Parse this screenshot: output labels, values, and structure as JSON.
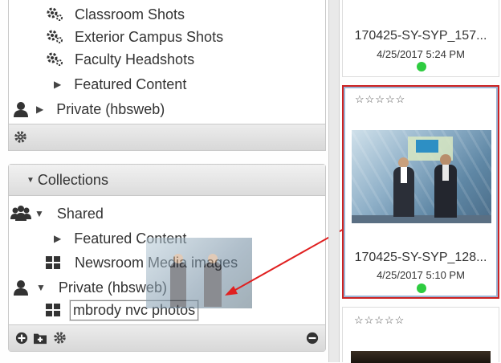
{
  "tree_top": {
    "items": [
      {
        "label": "Classroom Shots",
        "icon": "gears-icon"
      },
      {
        "label": "Exterior Campus Shots",
        "icon": "gears-icon"
      },
      {
        "label": "Faculty Headshots",
        "icon": "gears-icon"
      },
      {
        "label": "Featured Content",
        "icon": "triangle-right-icon"
      },
      {
        "label": "Private (hbsweb)",
        "icon": "user-icon"
      }
    ]
  },
  "collections": {
    "header": "Collections",
    "items": [
      {
        "label": "Shared",
        "icon": "users-icon"
      },
      {
        "label": "Featured Content",
        "icon": "triangle-right-icon"
      },
      {
        "label": "Newsroom Media images",
        "icon": "grid-icon"
      },
      {
        "label": "Private (hbsweb)",
        "icon": "user-icon"
      },
      {
        "label": "mbrody nvc photos",
        "icon": "grid-icon"
      }
    ]
  },
  "cards": [
    {
      "filename": "170425-SY-SYP_157...",
      "date": "4/25/2017 5:24 PM"
    },
    {
      "stars": "☆☆☆☆☆",
      "filename": "170425-SY-SYP_128...",
      "date": "4/25/2017 5:10 PM"
    },
    {
      "stars": "☆☆☆☆☆"
    }
  ],
  "colors": {
    "selected_border": "#cc2222",
    "status_dot": "#2ecc40",
    "arrow": "#e02020"
  }
}
